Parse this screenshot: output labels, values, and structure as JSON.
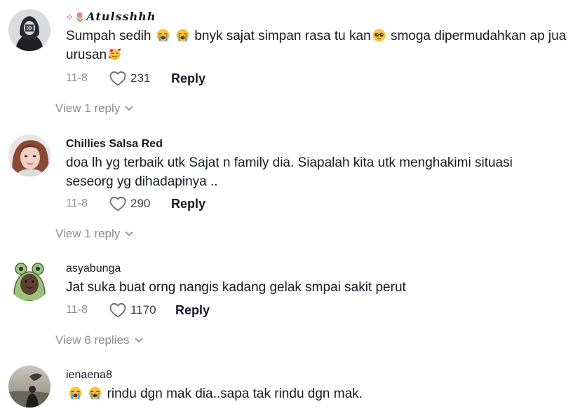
{
  "comments": [
    {
      "username": "𝑨𝒕𝒖𝒍𝒔𝒔𝒉𝒉𝒉",
      "username_prefix_icon": "tulip-sparkle-icon",
      "text_parts": [
        "Sumpah sedih",
        "bnyk sajat simpan rasa tu kan",
        "smoga dipermudahkan ap jua urusan"
      ],
      "emojis": [
        "loudly-crying-face",
        "loudly-crying-face",
        "pleading-face",
        "smiling-face-with-hearts"
      ],
      "date": "11-8",
      "likes": "231",
      "reply_label": "Reply",
      "view_replies": "View 1 reply"
    },
    {
      "username": "Chillies Salsa Red",
      "text": "doa lh yg terbaik utk Sajat n family dia. Siapalah kita utk menghakimi situasi seseorg yg dihadapinya ..",
      "date": "11-8",
      "likes": "290",
      "reply_label": "Reply",
      "view_replies": "View 1 reply"
    },
    {
      "username": "asyabunga",
      "text": "Jat suka buat orng nangis kadang gelak smpai sakit perut",
      "date": "11-8",
      "likes": "1170",
      "reply_label": "Reply",
      "view_replies": "View 6 replies"
    },
    {
      "username": "ienaena8",
      "text": "rindu dgn mak dia..sapa tak rindu dgn mak.",
      "emojis": [
        "loudly-crying-face",
        "loudly-crying-face"
      ]
    }
  ],
  "colors": {
    "text_primary": "#161823",
    "text_secondary": "#8a8b91",
    "background": "#ffffff"
  }
}
